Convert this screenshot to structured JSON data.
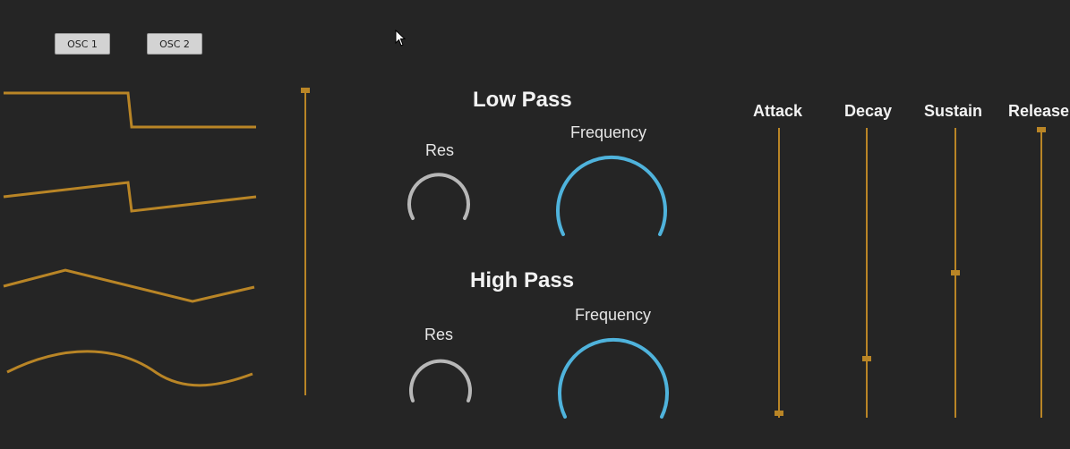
{
  "oscillator": {
    "buttons": [
      "OSC 1",
      "OSC 2"
    ],
    "waveforms": [
      "square-wave-icon",
      "sawtooth-wave-icon",
      "triangle-wave-icon",
      "sine-wave-icon"
    ],
    "selector_level": 1.0
  },
  "filters": {
    "low_pass": {
      "title": "Low Pass",
      "res_label": "Res",
      "freq_label": "Frequency"
    },
    "high_pass": {
      "title": "High Pass",
      "res_label": "Res",
      "freq_label": "Frequency"
    }
  },
  "envelope": {
    "labels": [
      "Attack",
      "Decay",
      "Sustain",
      "Release"
    ],
    "levels": {
      "attack": 0.0,
      "decay": 0.2,
      "sustain": 0.5,
      "release": 1.0
    }
  },
  "colors": {
    "background": "#252525",
    "accent_orange": "#b98526",
    "knob_blue": "#4fb3dc",
    "knob_grey": "#b7b7b7"
  }
}
